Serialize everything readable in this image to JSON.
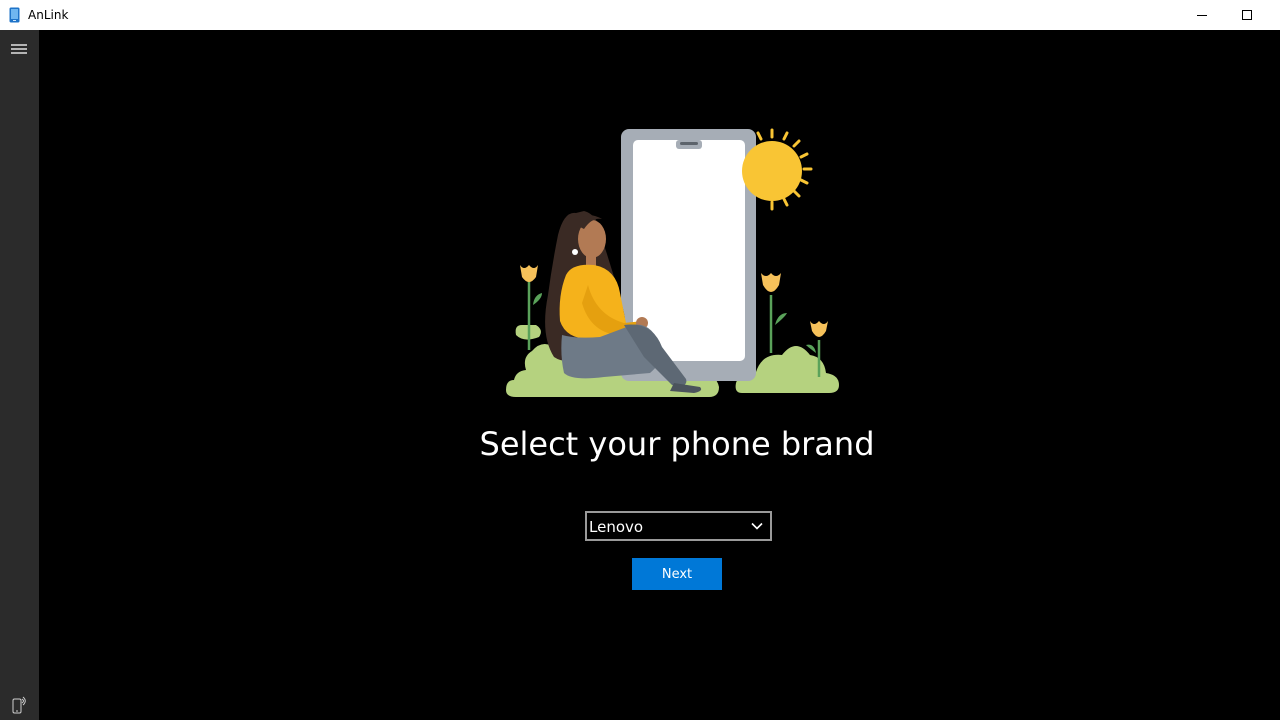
{
  "window": {
    "title": "AnLink",
    "icon": "phone-app-icon",
    "controls": [
      "minimize-icon",
      "maximize-icon"
    ]
  },
  "sidebar": {
    "menu_icon": "hamburger-menu-icon",
    "bottom_icon": "phone-device-icon"
  },
  "main": {
    "illustration": "woman-sitting-by-phone-illustration",
    "heading": "Select your phone brand",
    "brand_select": {
      "value": "Lenovo"
    },
    "next_label": "Next"
  },
  "colors": {
    "accent": "#0078d7",
    "background": "#000000",
    "sidebar": "#2b2b2b",
    "titlebar": "#ffffff"
  }
}
